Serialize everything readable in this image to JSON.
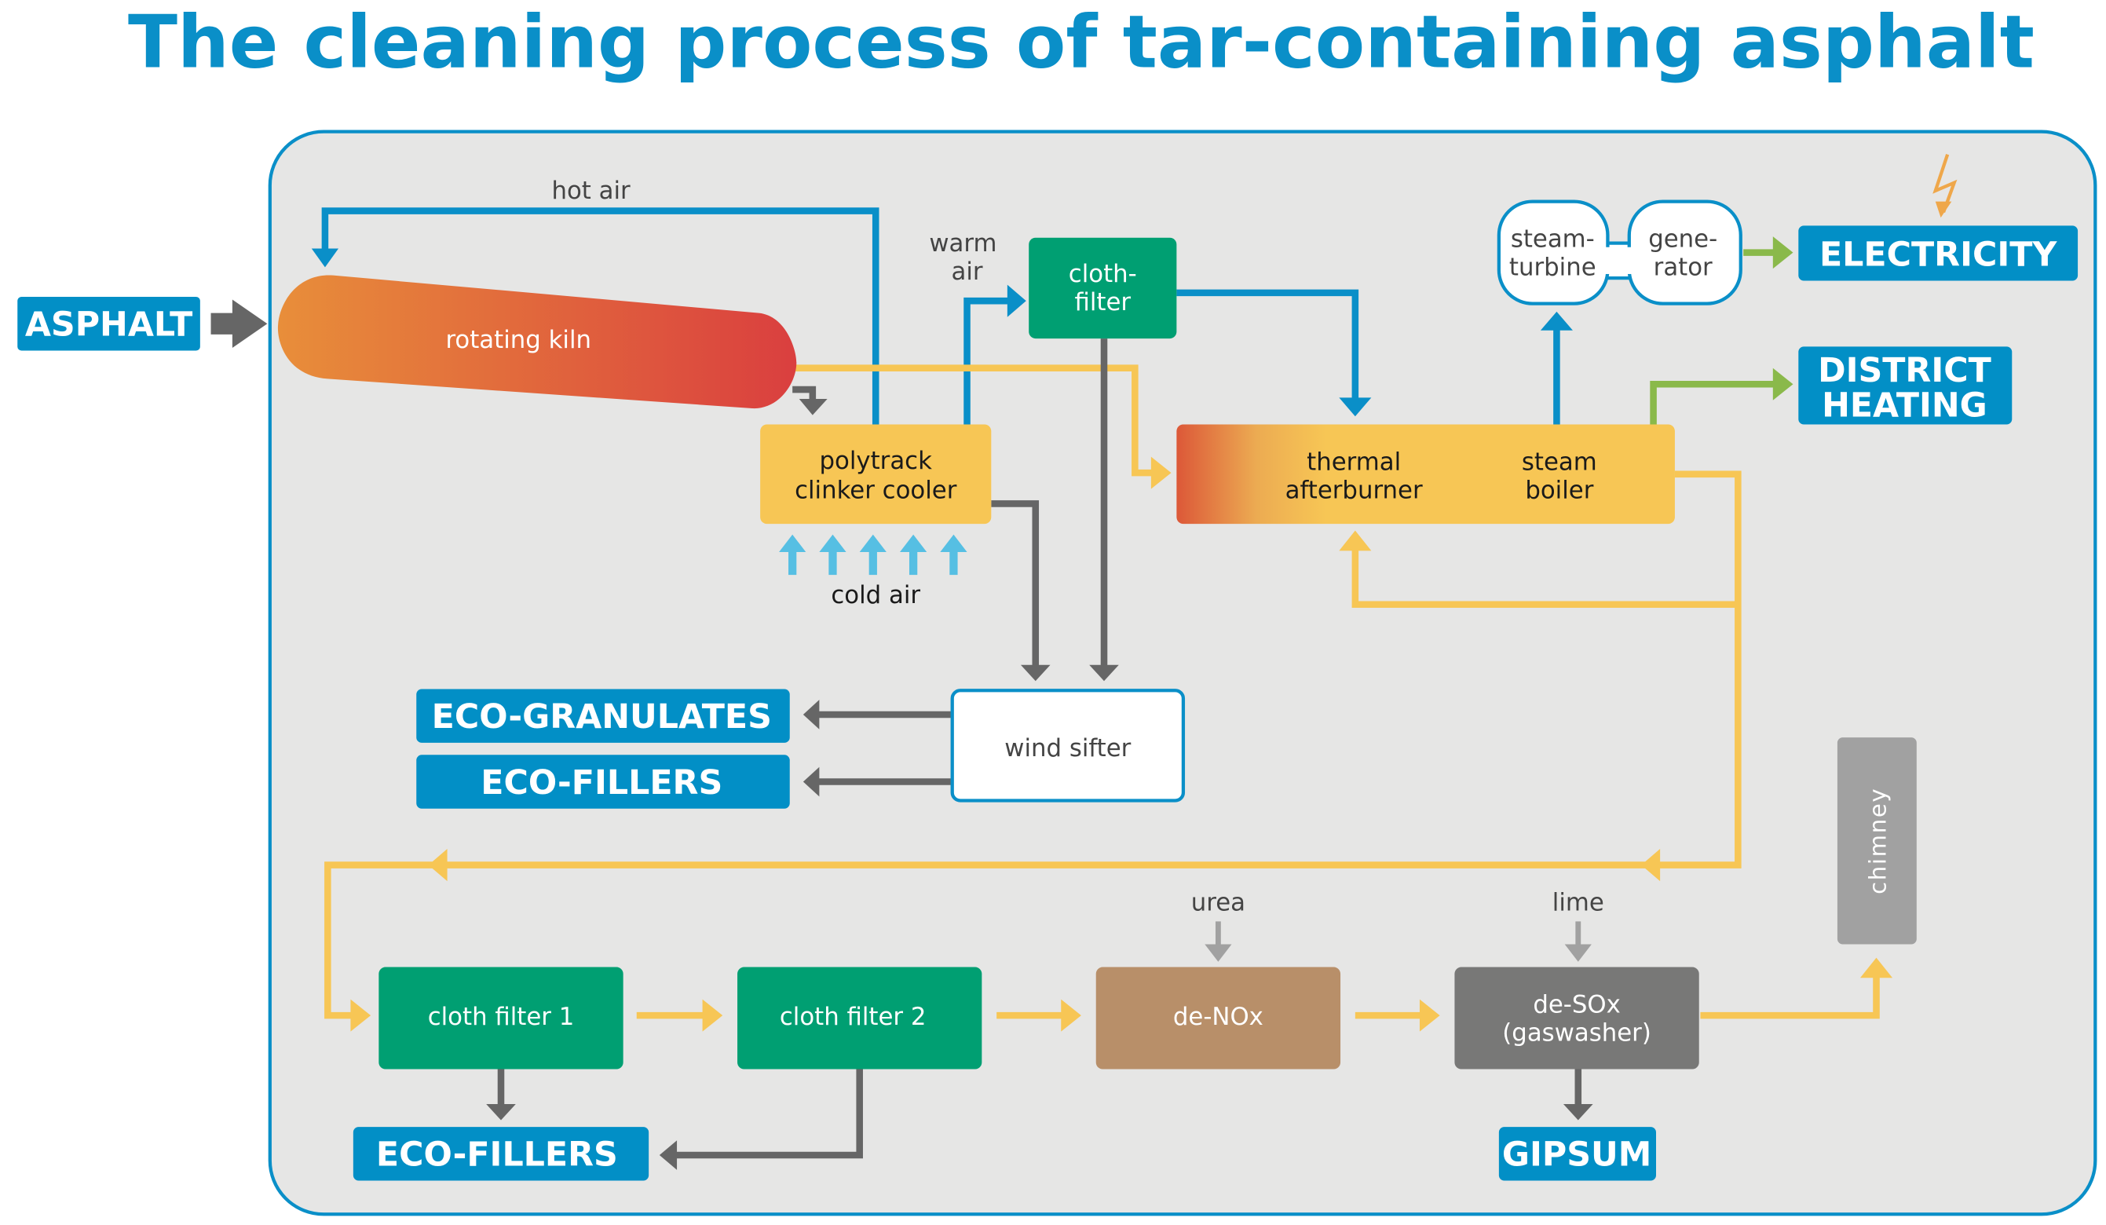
{
  "title": "The cleaning process of tar-containing asphalt",
  "colors": {
    "brand_blue": "#0a8fc8",
    "output_box": "#028fc6",
    "yellow_flow": "#f7c655",
    "grey_flow": "#666666",
    "green_flow": "#8ab94a",
    "cold_air": "#56bfe3",
    "cloth_filter_green": "#009f72",
    "denox_brown": "#b88f69",
    "desox_grey": "#787877",
    "chimney_grey": "#a1a1a1",
    "panel_bg": "#e6e6e5"
  },
  "inputs": {
    "asphalt": "ASPHALT"
  },
  "units": {
    "rotating_kiln": "rotating kiln",
    "clinker_cooler": [
      "polytrack",
      "clinker cooler"
    ],
    "cloth_filter_top": [
      "cloth-",
      "filter"
    ],
    "thermal_afterburner": [
      "thermal",
      "afterburner"
    ],
    "steam_boiler": [
      "steam",
      "boiler"
    ],
    "steam_turbine": [
      "steam-",
      "turbine"
    ],
    "generator": [
      "gene-",
      "rator"
    ],
    "wind_sifter": "wind sifter",
    "cloth_filter_1": "cloth filter 1",
    "cloth_filter_2": "cloth filter 2",
    "de_nox": "de-NOx",
    "de_sox": [
      "de-SOx",
      "(gaswasher)"
    ],
    "chimney": "chimney"
  },
  "flow_labels": {
    "hot_air": "hot air",
    "warm_air": [
      "warm",
      "air"
    ],
    "cold_air": "cold air",
    "urea": "urea",
    "lime": "lime"
  },
  "outputs": {
    "electricity": "ELECTRICITY",
    "district_heating": [
      "DISTRICT",
      "HEATING"
    ],
    "eco_granulates": "ECO-GRANULATES",
    "eco_fillers_sifter": "ECO-FILLERS",
    "eco_fillers_filters": "ECO-FILLERS",
    "gipsum": "GIPSUM"
  },
  "icons": {
    "electricity": "lightning-bolt-icon"
  }
}
